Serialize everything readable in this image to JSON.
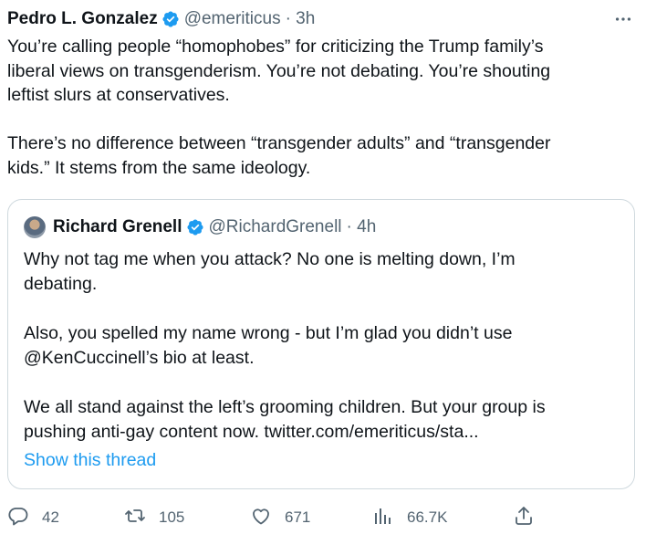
{
  "author": {
    "name": "Pedro L. Gonzalez",
    "handle": "@emeriticus",
    "time": "· 3h"
  },
  "tweet": {
    "text": "You’re calling people “homophobes” for criticizing the Trump family’s\nliberal views on transgenderism. You’re not debating. You’re shouting\nleftist slurs at conservatives.\n\nThere’s no difference between “transgender adults” and “transgender\nkids.” It stems from the same ideology."
  },
  "quote": {
    "name": "Richard Grenell",
    "handle": "@RichardGrenell",
    "time": "· 4h",
    "text": "Why not tag me when you attack? No one is melting down, I’m\ndebating.\n\nAlso, you spelled my name wrong - but I’m glad you didn’t use\n@KenCuccinell’s bio at least.\n\nWe all stand against the left’s grooming children. But your group is\npushing anti-gay content now. twitter.com/emeriticus/sta...",
    "show_thread": "Show this thread"
  },
  "actions": {
    "replies": "42",
    "retweets": "105",
    "likes": "671",
    "views": "66.7K"
  },
  "colors": {
    "text": "#0f1419",
    "secondary": "#536471",
    "accent": "#1d9bf0",
    "border": "#cfd9de"
  },
  "icons": [
    "verified-badge-icon",
    "more-icon",
    "reply-icon",
    "retweet-icon",
    "like-icon",
    "views-icon",
    "share-icon"
  ]
}
